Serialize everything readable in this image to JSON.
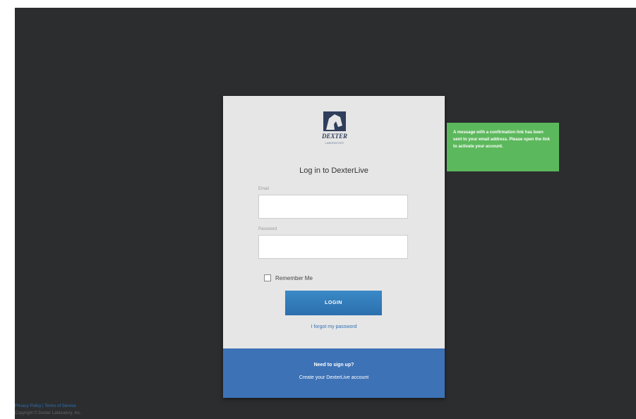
{
  "brand": {
    "logo_icon": "horse-head-logo-icon",
    "name": "DEXTER",
    "tagline": "LABORATORY"
  },
  "login": {
    "title": "Log in to DexterLive",
    "email_label": "Email",
    "email_value": "",
    "password_label": "Password",
    "password_value": "",
    "remember_label": "Remember Me",
    "remember_checked": false,
    "login_button": "LOGIN",
    "forgot_link": "I forgot my password"
  },
  "signup": {
    "question": "Need to sign up?",
    "link": "Create your DexterLive account"
  },
  "notification": {
    "message": "A message with a confirmation link has been sent to your email address. Please open the link to activate your account."
  },
  "footer": {
    "links": "Privacy Policy | Terms of Service",
    "copyright": "Copyright © Dexter Laboratory, Inc."
  },
  "colors": {
    "background": "#2b2d2f",
    "card": "#e6e6e6",
    "accent": "#3d72b6",
    "success": "#5cb85c"
  }
}
